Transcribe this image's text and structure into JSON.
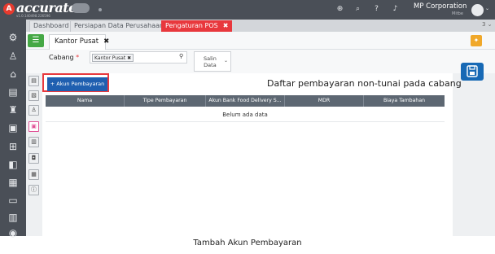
{
  "app": {
    "brand": "accurate",
    "version": "v1.0.140498.226596",
    "company": "MP Corporation",
    "user": "Mitbe"
  },
  "tabs": [
    {
      "label": "Dashboard"
    },
    {
      "label": "Persiapan Data Perusahaan"
    },
    {
      "label": "Pengaturan POS",
      "close": "✖",
      "active": true
    }
  ],
  "tab_count": "3 ⌄",
  "subtab": {
    "label": "Kantor Pusat",
    "close": "✖"
  },
  "form": {
    "cabang_label": "Cabang",
    "required_mark": "*",
    "cabang_chip": "Kantor Pusat ✖",
    "salin_label_1": "Salin",
    "salin_label_2": "Data"
  },
  "panel": {
    "add_button": "+ Akun Pembayaran",
    "title": "Daftar pembayaran non-tunai pada cabang",
    "columns": [
      "Nama",
      "Tipe Pembayaran",
      "Akun Bank Food Delivery S...",
      "MDR",
      "Biaya Tambahan"
    ],
    "empty_text": "Belum ada data"
  },
  "caption": "Tambah Akun Pembayaran",
  "colors": {
    "topbar": "#4a4f57",
    "active_tab": "#e8383d",
    "primary": "#1f5fb0",
    "save": "#1769b5",
    "highlight": "#e8383d"
  }
}
